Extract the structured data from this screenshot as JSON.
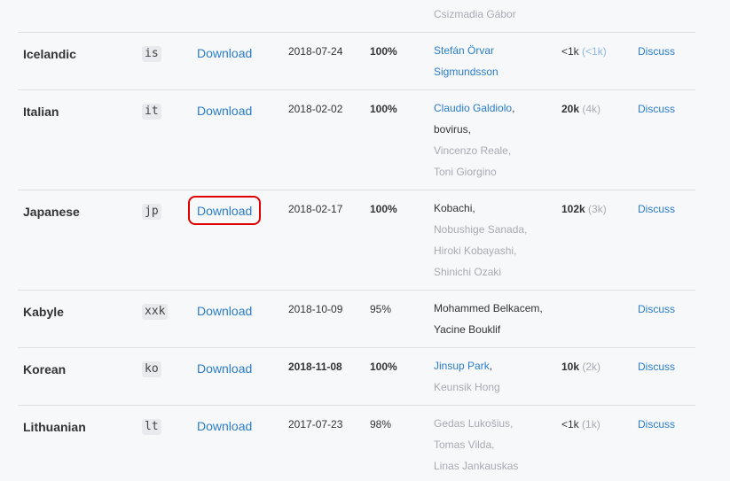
{
  "top_fragment": {
    "contributor": "Csizmadia Gábor"
  },
  "rows": [
    {
      "language": "Icelandic",
      "code": "is",
      "download_label": "Download",
      "date": "2018-07-24",
      "percent": "100%",
      "contributors": [
        "Stefán Örvar",
        "Sigmundsson"
      ],
      "count": "<1k",
      "count_sub": "(<1k)",
      "discuss_label": "Discuss"
    },
    {
      "language": "Italian",
      "code": "it",
      "download_label": "Download",
      "date": "2018-02-02",
      "percent": "100%",
      "contributors": [
        "Claudio Galdiolo",
        ",",
        "bovirus,",
        "Vincenzo Reale,",
        "Toni Giorgino"
      ],
      "count": "20k",
      "count_sub": "(4k)",
      "discuss_label": "Discuss"
    },
    {
      "language": "Japanese",
      "code": "jp",
      "download_label": "Download",
      "date": "2018-02-17",
      "percent": "100%",
      "contributors": [
        "Kobachi,",
        "Nobushige Sanada,",
        "Hiroki Kobayashi,",
        "Shinichi Ozaki"
      ],
      "count": "102k",
      "count_sub": "(3k)",
      "discuss_label": "Discuss"
    },
    {
      "language": "Kabyle",
      "code": "xxk",
      "download_label": "Download",
      "date": "2018-10-09",
      "percent": "95%",
      "contributors": [
        "Mohammed Belkacem,",
        "Yacine Bouklif"
      ],
      "discuss_label": "Discuss"
    },
    {
      "language": "Korean",
      "code": "ko",
      "download_label": "Download",
      "date": "2018-11-08",
      "percent": "100%",
      "contributors": [
        "Jinsup Park",
        ",",
        "Keunsik Hong"
      ],
      "count": "10k",
      "count_sub": "(2k)",
      "discuss_label": "Discuss"
    },
    {
      "language": "Lithuanian",
      "code": "lt",
      "download_label": "Download",
      "date": "2017-07-23",
      "percent": "98%",
      "contributors": [
        "Gedas Lukošius,",
        "Tomas Vilda,",
        "Linas Jankauskas"
      ],
      "count": "<1k",
      "count_sub": "(1k)",
      "discuss_label": "Discuss"
    }
  ]
}
